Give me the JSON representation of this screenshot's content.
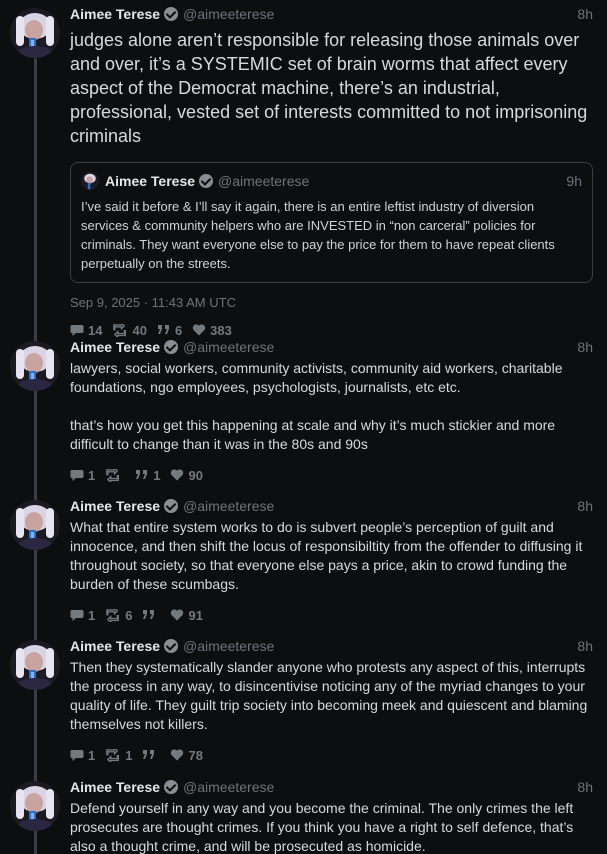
{
  "thread": {
    "main": {
      "name": "Aimee Terese",
      "handle": "@aimeeterese",
      "time": "8h",
      "text": "judges alone aren’t responsible for releasing those animals over and over, it’s a SYSTEMIC set of brain worms that affect every aspect of the Democrat machine, there’s an industrial, professional, vested set of interests committed to not imprisoning criminals",
      "quote": {
        "name": "Aimee Terese",
        "handle": "@aimeeterese",
        "time": "9h",
        "text": "I’ve said it before & I’ll say it again, there is an entire leftist industry of diversion services & community helpers who are INVESTED in “non carceral” policies for criminals. They want everyone else to pay the price for them to have repeat clients perpetually on the streets."
      },
      "date": "Sep 9, 2025 · 11:43 AM UTC",
      "stats": {
        "replies": "14",
        "retweets": "40",
        "quotes": "6",
        "likes": "383"
      }
    },
    "replies": [
      {
        "name": "Aimee Terese",
        "handle": "@aimeeterese",
        "time": "8h",
        "text": "lawyers, social workers, community activists, community aid workers, charitable foundations, ngo employees, psychologists, journalists, etc etc.\n\nthat’s how you get this happening at scale and why it’s much stickier and more difficult to change than it was in the 80s and 90s",
        "stats": {
          "replies": "1",
          "retweets": "",
          "quotes": "1",
          "likes": "90"
        }
      },
      {
        "name": "Aimee Terese",
        "handle": "@aimeeterese",
        "time": "8h",
        "text": "What that entire system works to do is subvert people’s perception of guilt and innocence, and then shift the locus of responsibiltity from the offender to diffusing it throughout society, so that everyone else pays a price, akin to crowd funding the burden of these scumbags.",
        "stats": {
          "replies": "1",
          "retweets": "6",
          "quotes": "",
          "likes": "91"
        }
      },
      {
        "name": "Aimee Terese",
        "handle": "@aimeeterese",
        "time": "8h",
        "text": "Then they systematically slander anyone who protests any aspect of this, interrupts the process in any way, to disincentivise noticing any of the myriad changes to your quality of life. They guilt trip society into becoming meek and quiescent and blaming themselves not killers.",
        "stats": {
          "replies": "1",
          "retweets": "1",
          "quotes": "",
          "likes": "78"
        }
      },
      {
        "name": "Aimee Terese",
        "handle": "@aimeeterese",
        "time": "8h",
        "text": "Defend yourself in any way and you become the criminal. The only crimes the left prosecutes are thought crimes. If you think you have a right to self defence, that’s also a thought crime, and will be prosecuted as homicide."
      }
    ]
  },
  "icons": {
    "reply": "comment-icon",
    "retweet": "retweet-icon",
    "quote": "quote-icon",
    "like": "heart-icon",
    "verified": "verified-badge-icon"
  },
  "colors": {
    "background": "#0d0e10",
    "text": "#d9d9d9",
    "muted": "#6e7378",
    "border": "#3a3d42"
  }
}
